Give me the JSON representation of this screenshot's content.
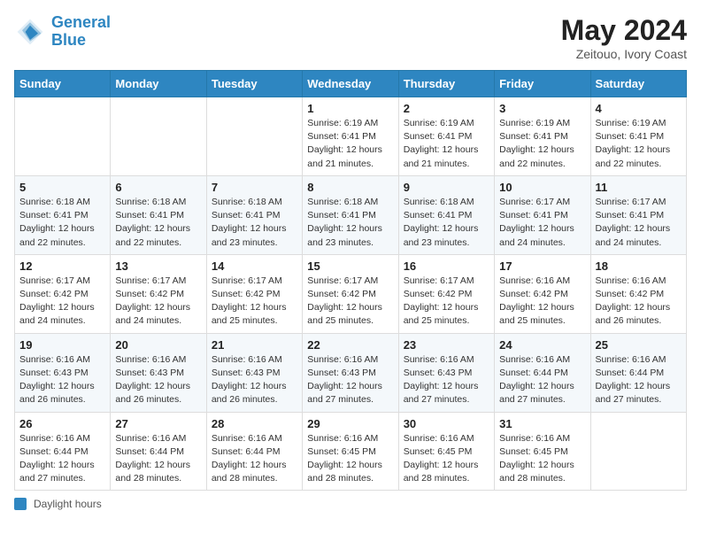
{
  "header": {
    "logo_line1": "General",
    "logo_line2": "Blue",
    "month_year": "May 2024",
    "location": "Zeitouo, Ivory Coast"
  },
  "days_of_week": [
    "Sunday",
    "Monday",
    "Tuesday",
    "Wednesday",
    "Thursday",
    "Friday",
    "Saturday"
  ],
  "weeks": [
    [
      {
        "day": "",
        "info": ""
      },
      {
        "day": "",
        "info": ""
      },
      {
        "day": "",
        "info": ""
      },
      {
        "day": "1",
        "info": "Sunrise: 6:19 AM\nSunset: 6:41 PM\nDaylight: 12 hours\nand 21 minutes."
      },
      {
        "day": "2",
        "info": "Sunrise: 6:19 AM\nSunset: 6:41 PM\nDaylight: 12 hours\nand 21 minutes."
      },
      {
        "day": "3",
        "info": "Sunrise: 6:19 AM\nSunset: 6:41 PM\nDaylight: 12 hours\nand 22 minutes."
      },
      {
        "day": "4",
        "info": "Sunrise: 6:19 AM\nSunset: 6:41 PM\nDaylight: 12 hours\nand 22 minutes."
      }
    ],
    [
      {
        "day": "5",
        "info": "Sunrise: 6:18 AM\nSunset: 6:41 PM\nDaylight: 12 hours\nand 22 minutes."
      },
      {
        "day": "6",
        "info": "Sunrise: 6:18 AM\nSunset: 6:41 PM\nDaylight: 12 hours\nand 22 minutes."
      },
      {
        "day": "7",
        "info": "Sunrise: 6:18 AM\nSunset: 6:41 PM\nDaylight: 12 hours\nand 23 minutes."
      },
      {
        "day": "8",
        "info": "Sunrise: 6:18 AM\nSunset: 6:41 PM\nDaylight: 12 hours\nand 23 minutes."
      },
      {
        "day": "9",
        "info": "Sunrise: 6:18 AM\nSunset: 6:41 PM\nDaylight: 12 hours\nand 23 minutes."
      },
      {
        "day": "10",
        "info": "Sunrise: 6:17 AM\nSunset: 6:41 PM\nDaylight: 12 hours\nand 24 minutes."
      },
      {
        "day": "11",
        "info": "Sunrise: 6:17 AM\nSunset: 6:41 PM\nDaylight: 12 hours\nand 24 minutes."
      }
    ],
    [
      {
        "day": "12",
        "info": "Sunrise: 6:17 AM\nSunset: 6:42 PM\nDaylight: 12 hours\nand 24 minutes."
      },
      {
        "day": "13",
        "info": "Sunrise: 6:17 AM\nSunset: 6:42 PM\nDaylight: 12 hours\nand 24 minutes."
      },
      {
        "day": "14",
        "info": "Sunrise: 6:17 AM\nSunset: 6:42 PM\nDaylight: 12 hours\nand 25 minutes."
      },
      {
        "day": "15",
        "info": "Sunrise: 6:17 AM\nSunset: 6:42 PM\nDaylight: 12 hours\nand 25 minutes."
      },
      {
        "day": "16",
        "info": "Sunrise: 6:17 AM\nSunset: 6:42 PM\nDaylight: 12 hours\nand 25 minutes."
      },
      {
        "day": "17",
        "info": "Sunrise: 6:16 AM\nSunset: 6:42 PM\nDaylight: 12 hours\nand 25 minutes."
      },
      {
        "day": "18",
        "info": "Sunrise: 6:16 AM\nSunset: 6:42 PM\nDaylight: 12 hours\nand 26 minutes."
      }
    ],
    [
      {
        "day": "19",
        "info": "Sunrise: 6:16 AM\nSunset: 6:43 PM\nDaylight: 12 hours\nand 26 minutes."
      },
      {
        "day": "20",
        "info": "Sunrise: 6:16 AM\nSunset: 6:43 PM\nDaylight: 12 hours\nand 26 minutes."
      },
      {
        "day": "21",
        "info": "Sunrise: 6:16 AM\nSunset: 6:43 PM\nDaylight: 12 hours\nand 26 minutes."
      },
      {
        "day": "22",
        "info": "Sunrise: 6:16 AM\nSunset: 6:43 PM\nDaylight: 12 hours\nand 27 minutes."
      },
      {
        "day": "23",
        "info": "Sunrise: 6:16 AM\nSunset: 6:43 PM\nDaylight: 12 hours\nand 27 minutes."
      },
      {
        "day": "24",
        "info": "Sunrise: 6:16 AM\nSunset: 6:44 PM\nDaylight: 12 hours\nand 27 minutes."
      },
      {
        "day": "25",
        "info": "Sunrise: 6:16 AM\nSunset: 6:44 PM\nDaylight: 12 hours\nand 27 minutes."
      }
    ],
    [
      {
        "day": "26",
        "info": "Sunrise: 6:16 AM\nSunset: 6:44 PM\nDaylight: 12 hours\nand 27 minutes."
      },
      {
        "day": "27",
        "info": "Sunrise: 6:16 AM\nSunset: 6:44 PM\nDaylight: 12 hours\nand 28 minutes."
      },
      {
        "day": "28",
        "info": "Sunrise: 6:16 AM\nSunset: 6:44 PM\nDaylight: 12 hours\nand 28 minutes."
      },
      {
        "day": "29",
        "info": "Sunrise: 6:16 AM\nSunset: 6:45 PM\nDaylight: 12 hours\nand 28 minutes."
      },
      {
        "day": "30",
        "info": "Sunrise: 6:16 AM\nSunset: 6:45 PM\nDaylight: 12 hours\nand 28 minutes."
      },
      {
        "day": "31",
        "info": "Sunrise: 6:16 AM\nSunset: 6:45 PM\nDaylight: 12 hours\nand 28 minutes."
      },
      {
        "day": "",
        "info": ""
      }
    ]
  ],
  "footer": {
    "daylight_label": "Daylight hours"
  }
}
